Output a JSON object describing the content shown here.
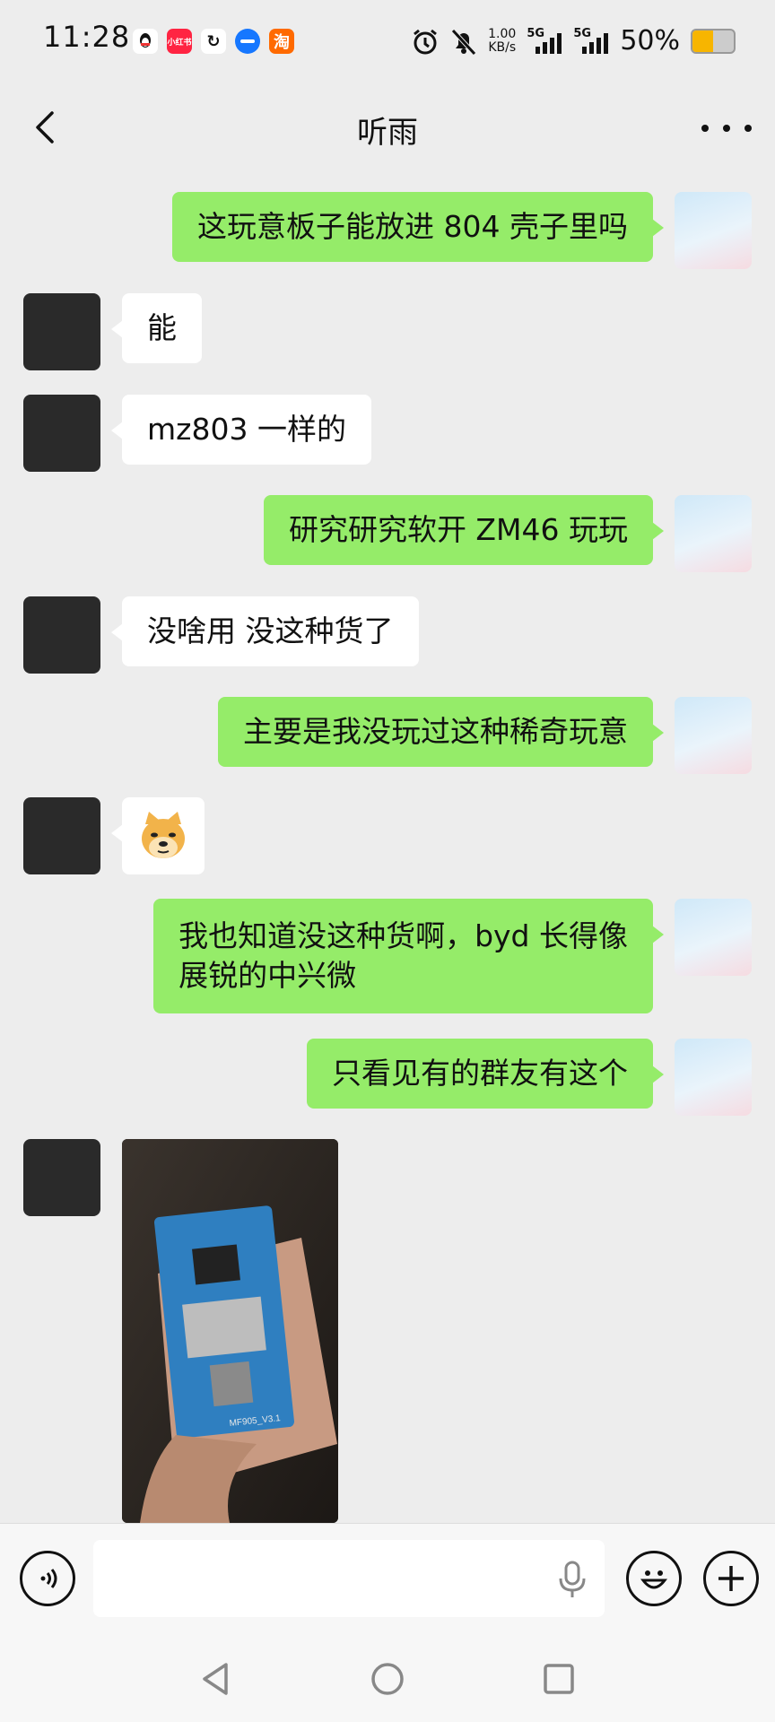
{
  "status_bar": {
    "time": "11:28",
    "app_icons": [
      {
        "name": "qq-icon",
        "label": "",
        "color": "#ffffff"
      },
      {
        "name": "xiaohongshu-icon",
        "label": "小红书",
        "color": "#ff2442"
      },
      {
        "name": "sync-icon",
        "label": "",
        "color": "#ffffff"
      },
      {
        "name": "chat-app-icon",
        "label": "",
        "color": "#1677ff"
      },
      {
        "name": "taobao-icon",
        "label": "淘",
        "color": "#ff6a00"
      }
    ],
    "net_speed_value": "1.00",
    "net_speed_unit": "KB/s",
    "signal_1": "5G",
    "signal_2": "5G",
    "battery_percent": "50%",
    "battery_level": 0.5
  },
  "header": {
    "title": "听雨"
  },
  "messages": [
    {
      "from": "me",
      "type": "text",
      "text": "这玩意板子能放进 804 壳子里吗"
    },
    {
      "from": "friend",
      "type": "text",
      "text": "能"
    },
    {
      "from": "friend",
      "type": "text",
      "text": "mz803 一样的"
    },
    {
      "from": "me",
      "type": "text",
      "text": "研究研究软开 ZM46 玩玩"
    },
    {
      "from": "friend",
      "type": "text",
      "text": "没啥用 没这种货了"
    },
    {
      "from": "me",
      "type": "text",
      "text": "主要是我没玩过这种稀奇玩意"
    },
    {
      "from": "friend",
      "type": "emoji",
      "text": "doge-emoji"
    },
    {
      "from": "me",
      "type": "text",
      "line1": "我也知道没这种货啊，byd 长得像",
      "line2": "展锐的中兴微"
    },
    {
      "from": "me",
      "type": "text",
      "text": "只看见有的群友有这个"
    },
    {
      "from": "friend",
      "type": "image",
      "board_label": "MF905_V3.1"
    }
  ],
  "input_bar": {
    "voice_icon": "voice-mode-icon",
    "mic_icon": "microphone-icon",
    "emoji_icon": "emoji-icon",
    "plus_icon": "plus-icon"
  },
  "system_nav": [
    "back-icon",
    "home-icon",
    "recents-icon"
  ]
}
